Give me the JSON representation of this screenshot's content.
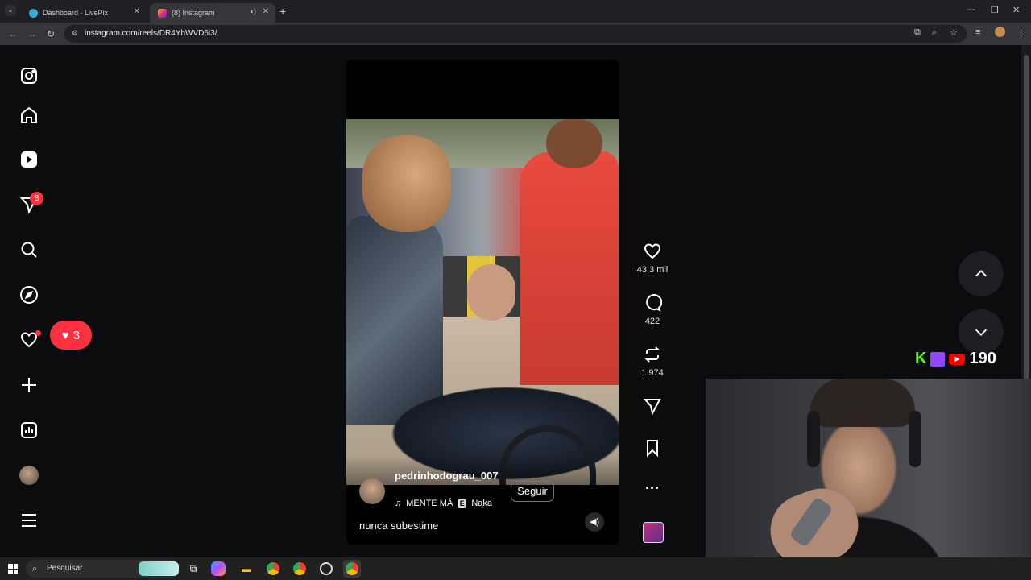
{
  "browser": {
    "tabs": [
      {
        "title": "Dashboard - LivePix",
        "active": false
      },
      {
        "title": "(8) Instagram",
        "active": true
      }
    ],
    "url": "instagram.com/reels/DR4YhWVD6i3/"
  },
  "sidebar": {
    "messages_badge": "8",
    "notifications_count": "3"
  },
  "reel": {
    "author": "pedrinhodograu_007",
    "follow_label": "Seguir",
    "music_title": "MENTE MÁ",
    "music_badge": "E",
    "music_artist": "Naka",
    "caption": "nunca subestime"
  },
  "actions": {
    "likes": "43,3 mil",
    "comments": "422",
    "reposts": "1.974"
  },
  "overlay": {
    "viewer_count": "190"
  },
  "taskbar": {
    "search_placeholder": "Pesquisar"
  },
  "colors": {
    "accent_red": "#ff3040",
    "kick_green": "#53fc18",
    "twitch_purple": "#9146ff",
    "youtube_red": "#ff0000"
  }
}
